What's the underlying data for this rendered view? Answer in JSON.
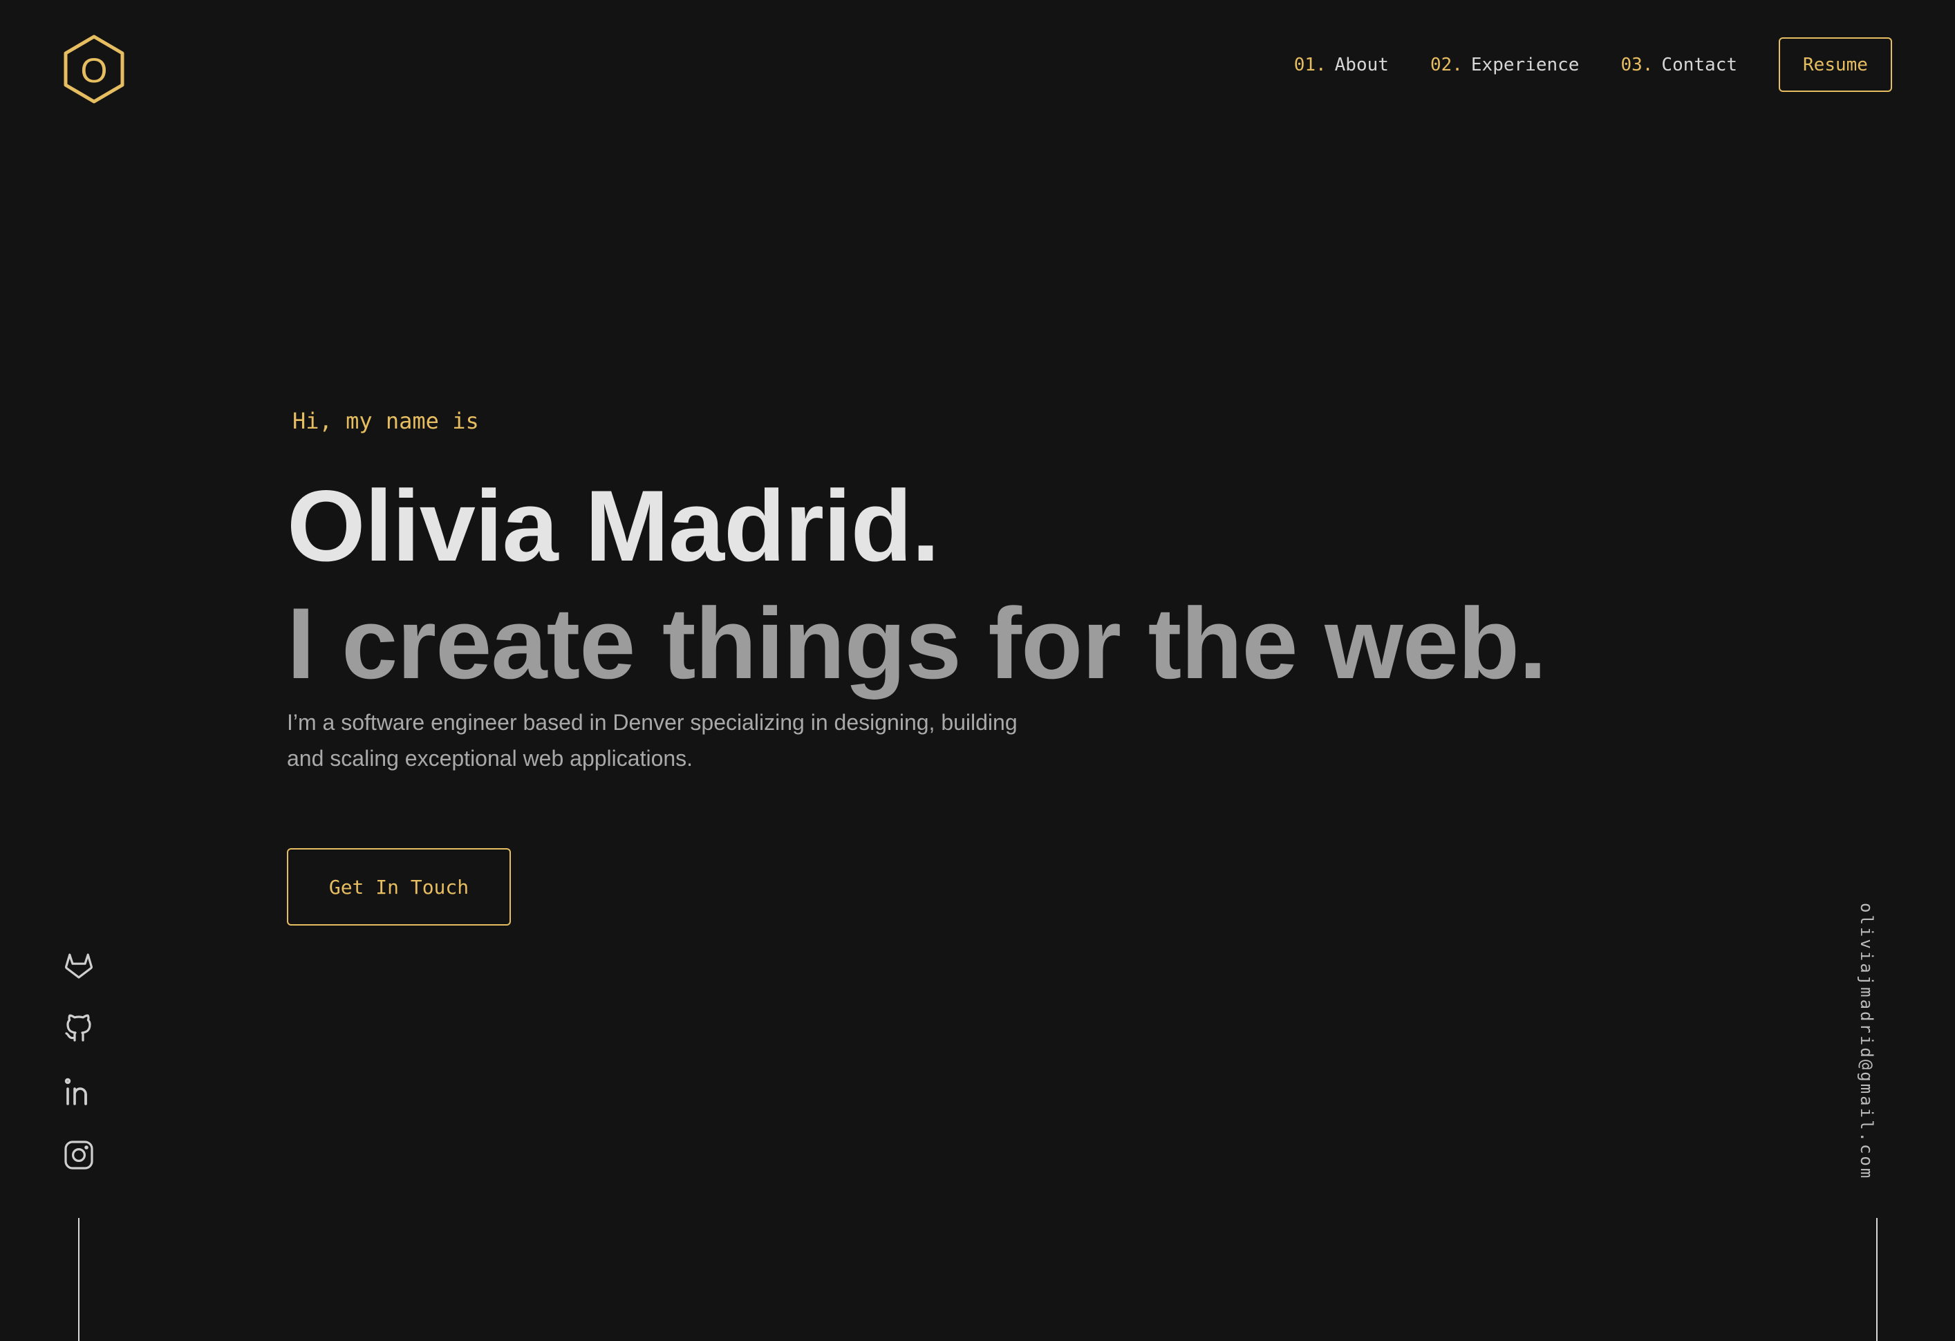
{
  "colors": {
    "background": "#131313",
    "accent": "#e6bd60",
    "heading": "#e4e4e4",
    "subheading": "#9c9c9c",
    "body_text": "#a9a9a9",
    "line": "#d9d9d9"
  },
  "logo": {
    "letter": "O",
    "icon": "hexagon-logo-icon"
  },
  "nav": {
    "items": [
      {
        "number": "01.",
        "label": "About"
      },
      {
        "number": "02.",
        "label": "Experience"
      },
      {
        "number": "03.",
        "label": "Contact"
      }
    ],
    "resume_label": "Resume"
  },
  "hero": {
    "greeting": "Hi, my name is",
    "name": "Olivia Madrid.",
    "tagline": "I create things for the web.",
    "bio": "I’m a software engineer based in Denver specializing in designing, building and scaling exceptional web applications.",
    "cta_label": "Get In Touch"
  },
  "social": {
    "links": [
      {
        "name": "GitLab",
        "icon": "gitlab-icon"
      },
      {
        "name": "GitHub",
        "icon": "github-icon"
      },
      {
        "name": "LinkedIn",
        "icon": "linkedin-icon"
      },
      {
        "name": "Instagram",
        "icon": "instagram-icon"
      }
    ]
  },
  "email": "oliviajmadrid@gmail.com"
}
